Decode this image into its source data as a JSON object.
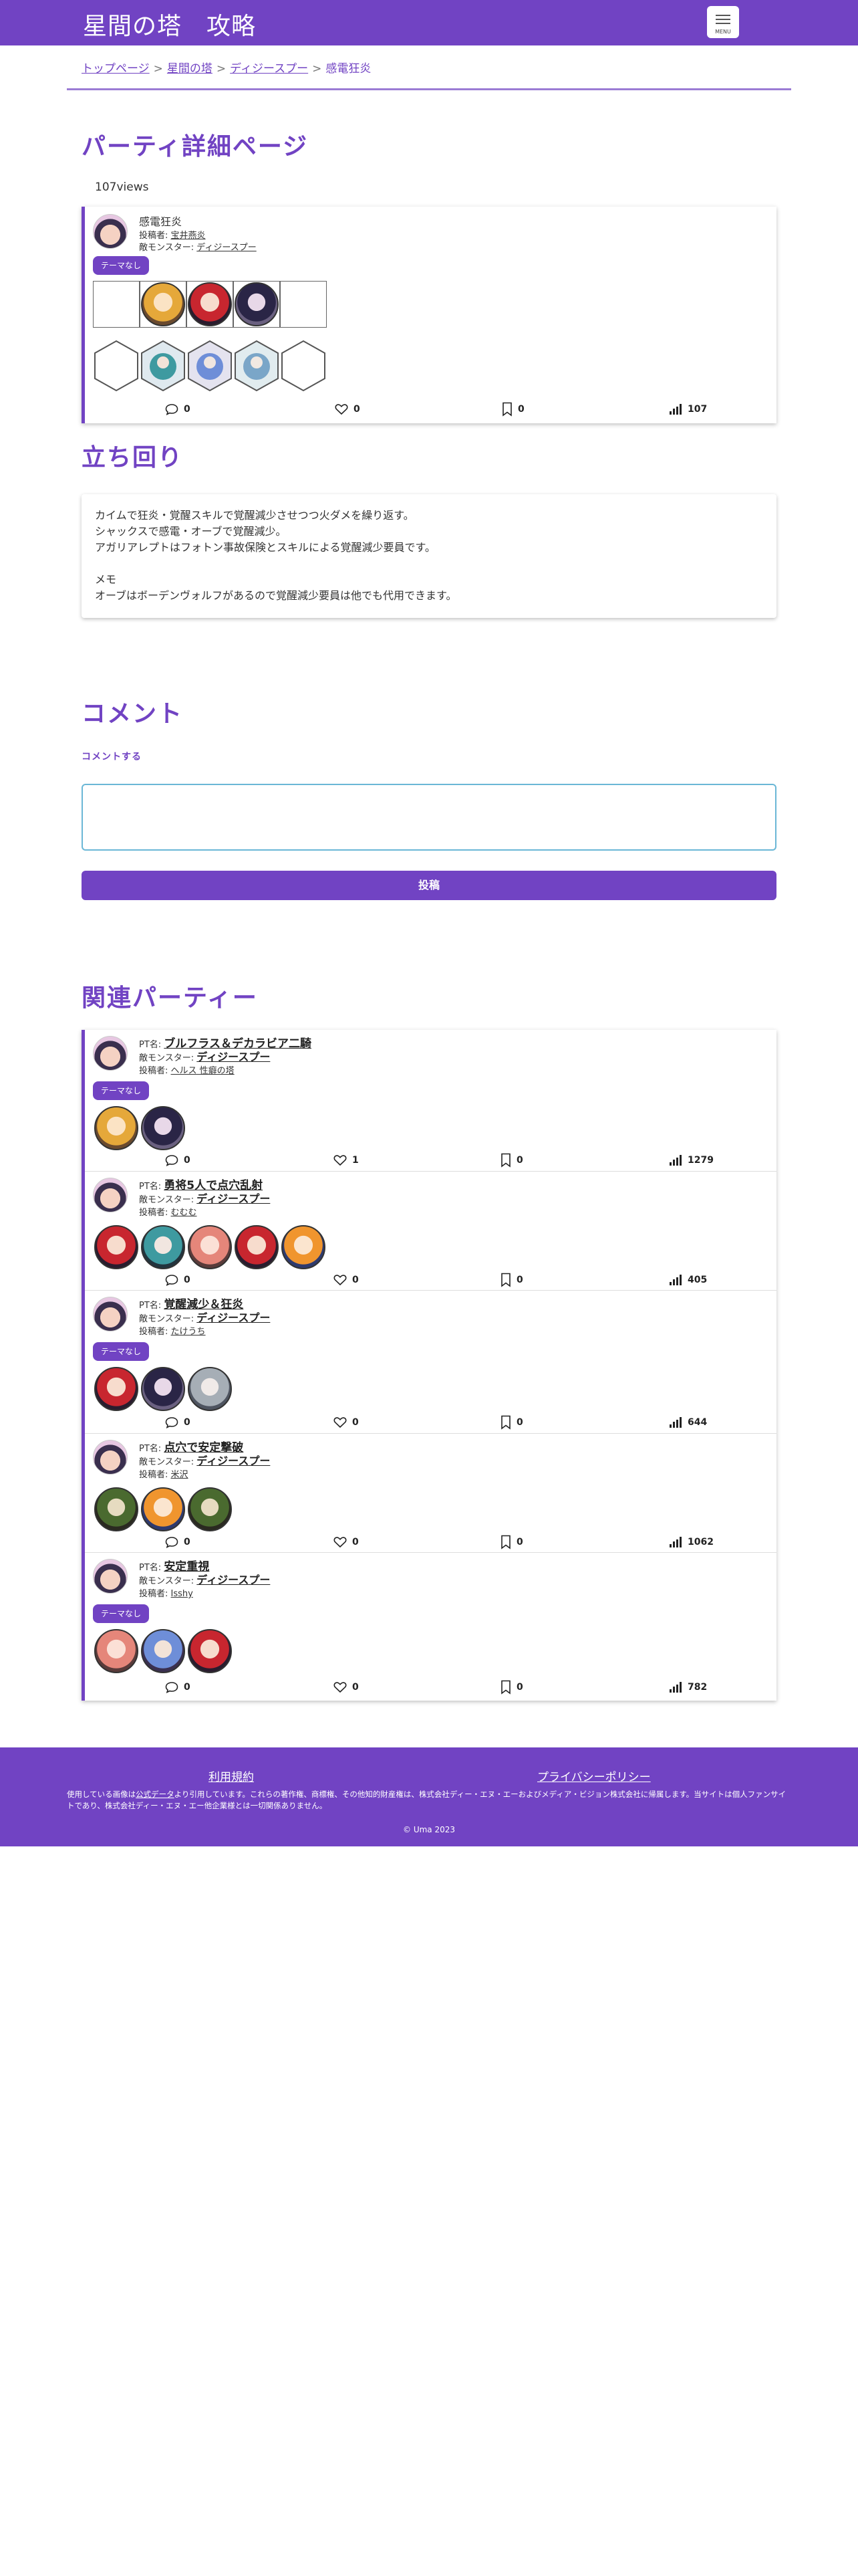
{
  "header": {
    "site_title": "星間の塔　攻略",
    "menu_label": "MENU"
  },
  "breadcrumb": [
    {
      "label": "トップページ"
    },
    {
      "label": "星間の塔"
    },
    {
      "label": "ディジースプー"
    },
    {
      "label": "感電狂炎"
    }
  ],
  "page": {
    "title": "パーティ詳細ページ",
    "views": "107views"
  },
  "party": {
    "name": "感電狂炎",
    "poster_label": "投稿者:",
    "poster": "宝井燕炎",
    "enemy_label": "敵モンスター:",
    "enemy": "ディジースプー",
    "theme": "テーマなし",
    "stats": {
      "comments": "0",
      "likes": "0",
      "bookmarks": "0",
      "views": "107"
    }
  },
  "strategy": {
    "title": "立ち回り",
    "lines": [
      "カイムで狂炎・覚醒スキルで覚醒減少させつつ火ダメを繰り返す。",
      "シャックスで感電・オーブで覚醒減少。",
      "アガリアレプトはフォトン事故保険とスキルによる覚醒減少要員です。",
      "",
      "メモ",
      "オーブはボーデンヴォルフがあるので覚醒減少要員は他でも代用できます。"
    ]
  },
  "comments": {
    "title": "コメント",
    "add_label": "コメントする",
    "submit_label": "投稿"
  },
  "related": {
    "title": "関連パーティー",
    "pt_label": "PT名:",
    "enemy_label": "敵モンスター:",
    "poster_label": "投稿者:",
    "items": [
      {
        "name": "ブルフラス＆デカラビア二騎",
        "enemy": "ディジースプー",
        "poster": "ヘルス 性癖の塔",
        "theme": "テーマなし",
        "comments": "0",
        "likes": "1",
        "bookmarks": "0",
        "views": "1279"
      },
      {
        "name": "勇将5人で点穴乱射",
        "enemy": "ディジースプー",
        "poster": "むむむ",
        "theme": "",
        "comments": "0",
        "likes": "0",
        "bookmarks": "0",
        "views": "405"
      },
      {
        "name": "覚醒減少＆狂炎",
        "enemy": "ディジースプー",
        "poster": "たけうち",
        "theme": "テーマなし",
        "comments": "0",
        "likes": "0",
        "bookmarks": "0",
        "views": "644"
      },
      {
        "name": "点穴で安定撃破",
        "enemy": "ディジースプー",
        "poster": "米沢",
        "theme": "",
        "comments": "0",
        "likes": "0",
        "bookmarks": "0",
        "views": "1062"
      },
      {
        "name": "安定重視",
        "enemy": "ディジースプー",
        "poster": "Isshy",
        "theme": "テーマなし",
        "comments": "0",
        "likes": "0",
        "bookmarks": "0",
        "views": "782"
      }
    ]
  },
  "footer": {
    "terms": "利用規約",
    "privacy": "プライバシーポリシー",
    "note_before": "使用している画像は",
    "note_link": "公式データ",
    "note_after": "より引用しています。これらの著作権、商標権、その他知的財産権は、株式会社ディー・エヌ・エーおよびメディア・ビジョン株式会社に帰属します。当サイトは個人ファンサイトであり、株式会社ディー・エヌ・エー他企業様とは一切関係ありません。",
    "copyright": "© Uma 2023"
  },
  "colors": {
    "brand": "#7143c3",
    "input_border": "#6ab7d6"
  }
}
